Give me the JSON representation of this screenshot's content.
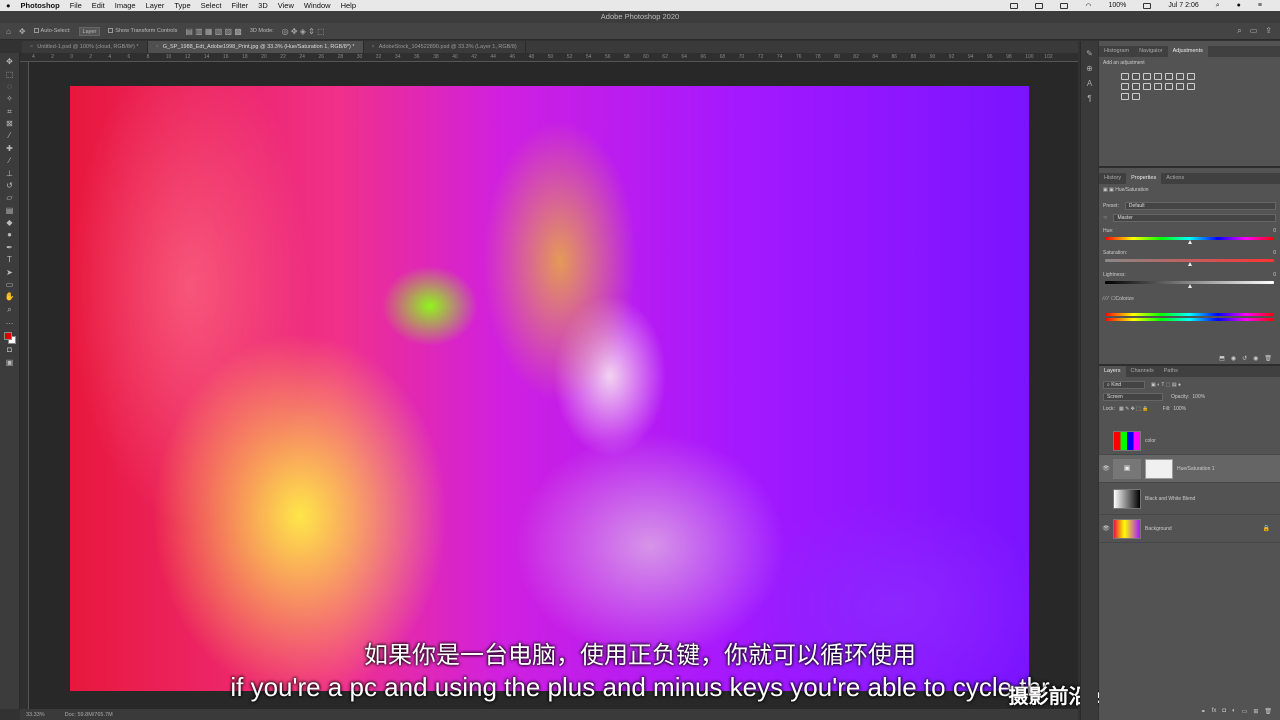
{
  "menubar": {
    "apple": "",
    "app": "Photoshop",
    "items": [
      "File",
      "Edit",
      "Image",
      "Layer",
      "Type",
      "Select",
      "Filter",
      "3D",
      "View",
      "Window",
      "Help"
    ],
    "battery": "100%",
    "clock": "Jul 7  2:06"
  },
  "window_title": "Adobe Photoshop 2020",
  "options_bar": {
    "auto_select_label": "Auto-Select:",
    "auto_select_value": "Layer",
    "transform_label": "Show Transform Controls",
    "mode_label": "3D Mode:"
  },
  "tabs": [
    {
      "label": "Untitled-1.psd @ 100% (cloud, RGB/8#) *",
      "active": false
    },
    {
      "label": "G_SP_1988_Edt_Adobe1998_Print.jpg @ 33.3% (Hue/Saturation 1, RGB/8*) *",
      "active": true
    },
    {
      "label": "AdobeStock_104522890.psd @ 33.3% (Layer 1, RGB/8)",
      "active": false
    }
  ],
  "ruler": [
    "4",
    "2",
    "0",
    "2",
    "4",
    "6",
    "8",
    "10",
    "12",
    "14",
    "16",
    "18",
    "20",
    "22",
    "24",
    "26",
    "28",
    "30",
    "32",
    "34",
    "36",
    "38",
    "40",
    "42",
    "44",
    "46",
    "48",
    "50",
    "52",
    "54",
    "56",
    "58",
    "60",
    "62",
    "64",
    "66",
    "68",
    "70",
    "72",
    "74",
    "76",
    "78",
    "80",
    "82",
    "84",
    "86",
    "88",
    "90",
    "92",
    "94",
    "96",
    "98",
    "100",
    "102"
  ],
  "subtitles": {
    "zh": "如果你是一台电脑，使用正负键，你就可以循环使用",
    "en": "if you're a pc and using the plus and minus keys you're able to cycle thr"
  },
  "watermark": "摄影前沿 sheyingzyz.com",
  "status": {
    "zoom": "33.33%",
    "doc": "Doc: 59.8M/765.7M"
  },
  "adjustments_panel": {
    "tabs": [
      "Histogram",
      "Navigator",
      "Adjustments"
    ],
    "active_tab": "Adjustments",
    "hint": "Add an adjustment"
  },
  "properties_panel": {
    "tabs": [
      "History",
      "Properties",
      "Actions"
    ],
    "active_tab": "Properties",
    "title": "Hue/Saturation",
    "preset_label": "Preset:",
    "preset_value": "Default",
    "channel_value": "Master",
    "hue_label": "Hue:",
    "hue_value": "0",
    "saturation_label": "Saturation:",
    "saturation_value": "0",
    "lightness_label": "Lightness:",
    "lightness_value": "0",
    "colorize_label": "Colorize"
  },
  "layers_panel": {
    "tabs": [
      "Layers",
      "Channels",
      "Paths"
    ],
    "active_tab": "Layers",
    "kind_label": "Kind",
    "blend_mode": "Screen",
    "opacity_label": "Opacity:",
    "opacity_value": "100%",
    "lock_label": "Lock:",
    "fill_label": "Fill:",
    "fill_value": "100%",
    "layers": [
      {
        "name": "color",
        "visible": false,
        "selected": false
      },
      {
        "name": "Hue/Saturation 1",
        "visible": true,
        "selected": true
      },
      {
        "name": "Black and White Blend",
        "visible": false,
        "selected": false
      },
      {
        "name": "Background",
        "visible": true,
        "selected": false
      }
    ]
  }
}
